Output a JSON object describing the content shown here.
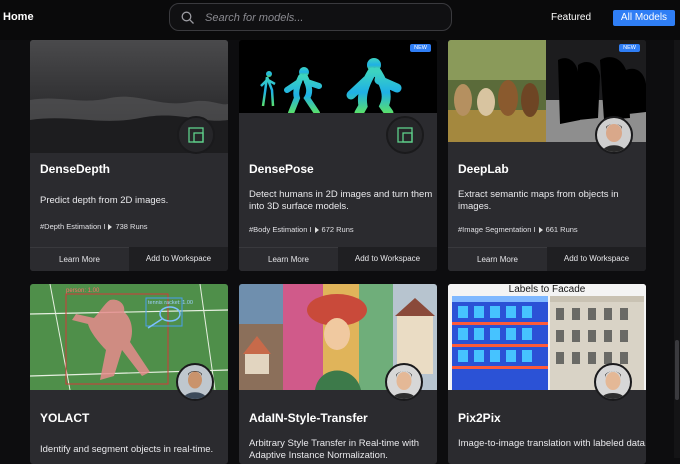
{
  "nav": {
    "home_label": "Home",
    "search_placeholder": "Search for models...",
    "featured_label": "Featured",
    "all_models_label": "All Models"
  },
  "common": {
    "learn_more": "Learn More",
    "add_to_workspace": "Add to Workspace",
    "new_badge": "NEW"
  },
  "cards": [
    {
      "title": "DenseDepth",
      "description": "Predict depth from 2D images.",
      "tag": "#Depth Estimation I",
      "runs": "738 Runs"
    },
    {
      "title": "DensePose",
      "description": "Detect humans in 2D images and turn them into 3D surface models.",
      "tag": "#Body Estimation I",
      "runs": "672 Runs"
    },
    {
      "title": "DeepLab",
      "description": "Extract semantic maps from objects in images.",
      "tag": "#Image Segmentation I",
      "runs": "661 Runs"
    },
    {
      "title": "YOLACT",
      "description": "Identify and segment objects in real-time."
    },
    {
      "title": "AdaIN-Style-Transfer",
      "description": "Arbitrary Style Transfer in Real-time with Adaptive Instance Normalization."
    },
    {
      "title": "Pix2Pix",
      "description": "Image-to-image translation with labeled data.",
      "thumb_label": "Labels to Facade"
    }
  ],
  "yolact_labels": {
    "person": "person: 1.00",
    "racket": "tennis racket: 1.00"
  },
  "colors": {
    "accent": "#2f7ef5",
    "card_bg": "#2b2b2f",
    "page_bg": "#0d0d0f"
  }
}
